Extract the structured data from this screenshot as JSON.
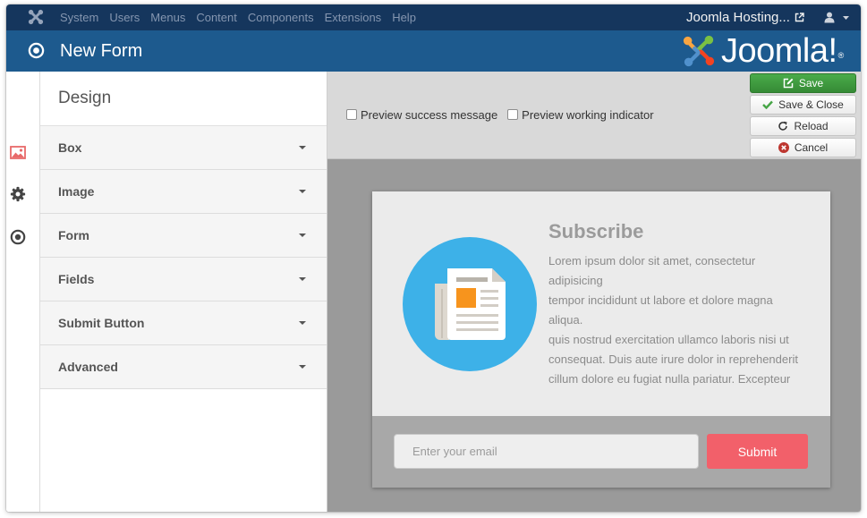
{
  "topbar": {
    "logo_icon": "joomla-icon",
    "menu": [
      "System",
      "Users",
      "Menus",
      "Content",
      "Components",
      "Extensions",
      "Help"
    ],
    "site_link": "Joomla Hosting...",
    "site_link_icon": "external-link-icon",
    "user_icon": "user-icon",
    "user_menu_icon": "caret-down-icon"
  },
  "header": {
    "icon": "target-icon",
    "title": "New Form",
    "logo_text": "Joomla!",
    "logo_mark": "®"
  },
  "sidebar": {
    "tabs": [
      {
        "icon": "image-icon",
        "active": true
      },
      {
        "icon": "gear-icon",
        "active": false
      },
      {
        "icon": "target-icon",
        "active": false
      }
    ]
  },
  "panel": {
    "title": "Design",
    "sections": [
      {
        "label": "Box",
        "expanded": false
      },
      {
        "label": "Image",
        "expanded": false
      },
      {
        "label": "Form",
        "expanded": false
      },
      {
        "label": "Fields",
        "expanded": false
      },
      {
        "label": "Submit Button",
        "expanded": false
      },
      {
        "label": "Advanced",
        "expanded": false
      }
    ]
  },
  "toolbar": {
    "options": [
      {
        "label": "Preview success message",
        "checked": false
      },
      {
        "label": "Preview working indicator",
        "checked": false
      }
    ],
    "actions": [
      {
        "label": "Save",
        "icon": "edit-icon"
      },
      {
        "label": "Save & Close",
        "icon": "check-icon"
      },
      {
        "label": "Reload",
        "icon": "reload-icon"
      },
      {
        "label": "Cancel",
        "icon": "cancel-icon"
      }
    ]
  },
  "preview": {
    "image_icon": "newspaper-icon",
    "heading": "Subscribe",
    "body_lines": [
      "Lorem ipsum dolor sit amet, consectetur",
      "adipisicing",
      "tempor incididunt ut labore et dolore magna",
      "aliqua.",
      "quis nostrud exercitation ullamco laboris nisi ut",
      "consequat. Duis aute irure dolor in reprehenderit",
      "cillum dolore eu fugiat nulla pariatur. Excepteur"
    ],
    "email_placeholder": "Enter your email",
    "email_value": "",
    "submit_label": "Submit"
  },
  "colors": {
    "navbar": "#15365d",
    "header": "#1d5a8e",
    "save_button": "#3f9e3f",
    "active_tab_icon": "#e86a6a",
    "badge_circle": "#3db1e8",
    "submit_button": "#f2606a",
    "cancel_icon": "#bd362f"
  }
}
